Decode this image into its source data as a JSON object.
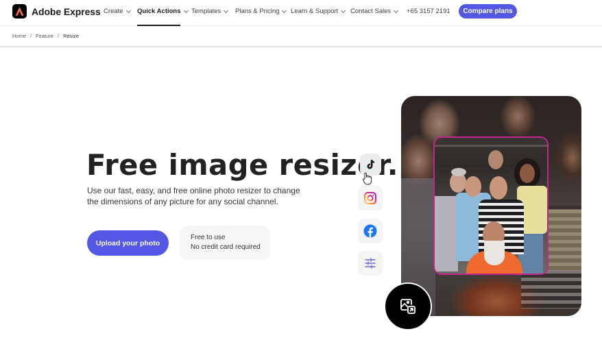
{
  "header": {
    "brand": "Adobe Express",
    "nav_items": [
      {
        "label": "Create",
        "has_dropdown": true,
        "active": false
      },
      {
        "label": "Quick Actions",
        "has_dropdown": true,
        "active": true
      },
      {
        "label": "Templates",
        "has_dropdown": true,
        "active": false
      },
      {
        "label": "Plans & Pricing",
        "has_dropdown": true,
        "active": false
      },
      {
        "label": "Learn & Support",
        "has_dropdown": true,
        "active": false
      },
      {
        "label": "Contact Sales",
        "has_dropdown": true,
        "active": false
      }
    ],
    "phone": "+65 3157 2191",
    "cta_label": "Compare plans",
    "accent_color": "#5258e4"
  },
  "breadcrumb": {
    "items": [
      "Home",
      "Feature",
      "Resize"
    ],
    "separator": "/"
  },
  "hero": {
    "title": "Free image resizer.",
    "description": "Use our fast, easy, and free online photo resizer to change the dimensions of any picture for any social channel.",
    "upload_label": "Upload your photo",
    "info_lines": [
      "Free to use",
      "No credit card required"
    ]
  },
  "preview": {
    "social_icons": [
      "tiktok-icon",
      "instagram-icon",
      "facebook-icon",
      "adjustments-icon"
    ],
    "crop_frame_color": "#c2268c",
    "action_icon": "image-resize-icon",
    "image_alt": "Group photo of diverse smiling people"
  }
}
